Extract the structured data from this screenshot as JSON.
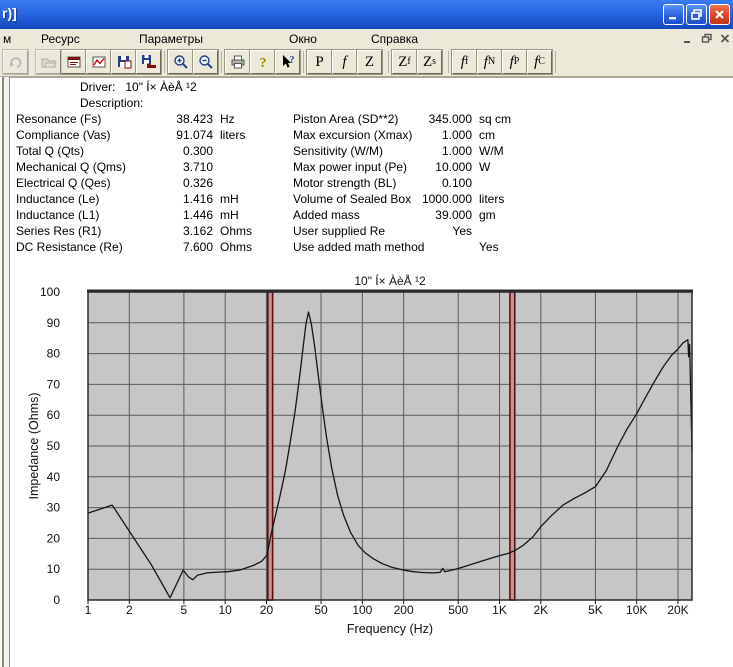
{
  "window": {
    "title": "r)]",
    "controls": [
      "minimize",
      "restore",
      "close"
    ],
    "mdi_controls": [
      "minimize",
      "restore",
      "close"
    ]
  },
  "menu": {
    "items": [
      {
        "label": "м"
      },
      {
        "label": "Ресурс"
      },
      {
        "label": "Параметры"
      },
      {
        "label": "Окно"
      },
      {
        "label": "Справка"
      }
    ]
  },
  "toolbar": {
    "icon_buttons": [
      "redo-icon",
      "open-folder-icon",
      "driver-params-window-icon",
      "graph-icon",
      "save-icon",
      "export-save-icon",
      "zoom-in-icon",
      "zoom-out-icon",
      "print-icon",
      "help-icon",
      "context-help-icon"
    ],
    "letters": [
      {
        "main": "P",
        "sub": ""
      },
      {
        "main": "f",
        "sub": ""
      },
      {
        "main": "Z",
        "sub": ""
      },
      {
        "main": "Z",
        "sub": "f"
      },
      {
        "main": "Z",
        "sub": "s"
      },
      {
        "main": "f",
        "sub": "f"
      },
      {
        "main": "f",
        "sub": "N"
      },
      {
        "main": "f",
        "sub": "P"
      },
      {
        "main": "f",
        "sub": "C"
      }
    ]
  },
  "params": {
    "driver_label": "Driver:",
    "driver_value": "10\" Í× ÀèÅ ¹2",
    "description_label": "Description:",
    "left": [
      {
        "label": "Resonance (Fs)",
        "value": "38.423",
        "unit": "Hz"
      },
      {
        "label": "Compliance (Vas)",
        "value": "91.074",
        "unit": "liters"
      },
      {
        "label": "Total Q (Qts)",
        "value": "0.300",
        "unit": ""
      },
      {
        "label": "Mechanical Q (Qms)",
        "value": "3.710",
        "unit": ""
      },
      {
        "label": "Electrical Q (Qes)",
        "value": "0.326",
        "unit": ""
      },
      {
        "label": "Inductance (Le)",
        "value": "1.416",
        "unit": "mH"
      },
      {
        "label": "Inductance (L1)",
        "value": "1.446",
        "unit": "mH"
      },
      {
        "label": "Series Res (R1)",
        "value": "3.162",
        "unit": "Ohms"
      },
      {
        "label": "DC Resistance (Re)",
        "value": "7.600",
        "unit": "Ohms"
      }
    ],
    "right": [
      {
        "label": "Piston Area (SD**2)",
        "value": "345.000",
        "unit": "sq cm"
      },
      {
        "label": "Max excursion (Xmax)",
        "value": "1.000",
        "unit": "cm"
      },
      {
        "label": "Sensitivity (W/M)",
        "value": "1.000",
        "unit": "W/M"
      },
      {
        "label": "Max power input (Pe)",
        "value": "10.000",
        "unit": "W"
      },
      {
        "label": "Motor strength (BL)",
        "value": "0.100",
        "unit": ""
      },
      {
        "label": "Volume of Sealed Box",
        "value": "1000.000",
        "unit": "liters"
      },
      {
        "label": "Added mass",
        "value": "39.000",
        "unit": "gm"
      },
      {
        "label": "User supplied Re",
        "value": "Yes",
        "unit": ""
      },
      {
        "label": "Use added math method",
        "value": "",
        "unit": "Yes"
      }
    ]
  },
  "chart_data": {
    "type": "line",
    "title": "10\" Í× ÀèÅ ¹2",
    "xlabel": "Frequency (Hz)",
    "ylabel": "Impedance (Ohms)",
    "x_scale": "log",
    "x_max": 25300,
    "ylim": [
      0,
      100
    ],
    "y_ticks": [
      0,
      10,
      20,
      30,
      40,
      50,
      60,
      70,
      80,
      90,
      100
    ],
    "x_ticks": [
      {
        "value": 1,
        "label": "1"
      },
      {
        "value": 2,
        "label": "2"
      },
      {
        "value": 5,
        "label": "5"
      },
      {
        "value": 10,
        "label": "10"
      },
      {
        "value": 20,
        "label": "20"
      },
      {
        "value": 50,
        "label": "50"
      },
      {
        "value": 100,
        "label": "100"
      },
      {
        "value": 200,
        "label": "200"
      },
      {
        "value": 500,
        "label": "500"
      },
      {
        "value": 1000,
        "label": "1K"
      },
      {
        "value": 2000,
        "label": "2K"
      },
      {
        "value": 5000,
        "label": "5K"
      },
      {
        "value": 10000,
        "label": "10K"
      },
      {
        "value": 20000,
        "label": "20K"
      }
    ],
    "cursor_markers_hz": [
      21.3,
      1240
    ],
    "colors": {
      "plot_bg": "#c6c6c6",
      "grid": "#5a5a5a",
      "marker_fill": "#c49898",
      "marker_edge": "#5c0f0f",
      "curve": "#151515",
      "text": "#111111"
    },
    "legend": "none",
    "series": [
      {
        "name": "impedance",
        "color": "#151515",
        "points": [
          [
            1,
            28.2
          ],
          [
            1.5,
            30.8
          ],
          [
            2.2,
            19.5
          ],
          [
            2.9,
            11.4
          ],
          [
            3.35,
            6.5
          ],
          [
            3.96,
            0.7
          ],
          [
            4.94,
            9.7
          ],
          [
            5.4,
            7.5
          ],
          [
            5.8,
            6.6
          ],
          [
            6.3,
            8.1
          ],
          [
            7.4,
            8.8
          ],
          [
            9.2,
            9.1
          ],
          [
            10.5,
            9.2
          ],
          [
            13,
            9.8
          ],
          [
            16,
            11.2
          ],
          [
            18.5,
            12.6
          ],
          [
            20.2,
            14.6
          ],
          [
            21.3,
            20
          ],
          [
            23,
            26.5
          ],
          [
            25,
            33.5
          ],
          [
            27.5,
            42
          ],
          [
            30,
            52
          ],
          [
            32.5,
            62
          ],
          [
            35,
            73
          ],
          [
            37,
            82
          ],
          [
            38.8,
            89.5
          ],
          [
            40.5,
            93.5
          ],
          [
            42.5,
            89.5
          ],
          [
            45,
            82
          ],
          [
            48,
            72
          ],
          [
            51.5,
            61.5
          ],
          [
            55,
            52.5
          ],
          [
            60,
            42.5
          ],
          [
            66,
            34
          ],
          [
            73,
            27.5
          ],
          [
            82,
            22
          ],
          [
            93,
            17.8
          ],
          [
            105,
            15.3
          ],
          [
            120,
            13.4
          ],
          [
            140,
            11.8
          ],
          [
            165,
            10.6
          ],
          [
            195,
            9.8
          ],
          [
            235,
            9.2
          ],
          [
            280,
            8.9
          ],
          [
            330,
            8.8
          ],
          [
            370,
            9
          ],
          [
            385,
            10.3
          ],
          [
            398,
            9.2
          ],
          [
            430,
            9.5
          ],
          [
            470,
            9.9
          ],
          [
            520,
            10.5
          ],
          [
            580,
            11.1
          ],
          [
            660,
            11.9
          ],
          [
            750,
            12.7
          ],
          [
            860,
            13.5
          ],
          [
            1000,
            14.4
          ],
          [
            1150,
            15.1
          ],
          [
            1300,
            16.1
          ],
          [
            1500,
            17.9
          ],
          [
            1750,
            20.5
          ],
          [
            2000,
            23.8
          ],
          [
            2400,
            27.5
          ],
          [
            2900,
            30.8
          ],
          [
            3500,
            33
          ],
          [
            4200,
            34.8
          ],
          [
            5000,
            36.8
          ],
          [
            6000,
            42
          ],
          [
            7300,
            50
          ],
          [
            8500,
            55.5
          ],
          [
            10000,
            60.5
          ],
          [
            11500,
            65.5
          ],
          [
            13500,
            71
          ],
          [
            15500,
            75.5
          ],
          [
            18000,
            79.5
          ],
          [
            20000,
            81.5
          ],
          [
            21800,
            83.5
          ],
          [
            23600,
            84.5
          ],
          [
            23900,
            79
          ],
          [
            24300,
            83
          ],
          [
            25300,
            48.5
          ]
        ]
      }
    ]
  }
}
